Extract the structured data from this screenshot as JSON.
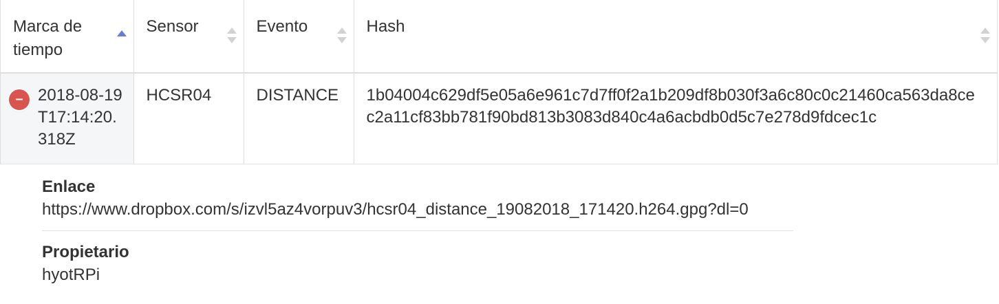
{
  "table": {
    "columns": [
      {
        "label": "Marca de tiempo",
        "sort": "ascending"
      },
      {
        "label": "Sensor",
        "sort": "none"
      },
      {
        "label": "Evento",
        "sort": "none"
      },
      {
        "label": "Hash",
        "sort": "none"
      }
    ],
    "rows": [
      {
        "expand_icon": "minus-circle-icon",
        "timestamp": "2018-08-19T17:14:20.318Z",
        "sensor": "HCSR04",
        "event": "DISTANCE",
        "hash": "1b04004c629df5e05a6e961c7d7ff0f2a1b209df8b030f3a6c80c0c21460ca563da8cec2a11cf83bb781f90bd813b3083d840c4a6acbdb0d5c7e278d9fdcec1c"
      }
    ]
  },
  "details": {
    "link_label": "Enlace",
    "link_value": "https://www.dropbox.com/s/izvl5az4vorpuv3/hcsr04_distance_19082018_171420.h264.gpg?dl=0",
    "owner_label": "Propietario",
    "owner_value": "hyotRPi"
  },
  "colors": {
    "expand_button": "#d9534f",
    "sort_active": "#6a7bd6",
    "sort_inactive": "#d2d2d2",
    "first_cell_bg": "#f5f6f8"
  }
}
